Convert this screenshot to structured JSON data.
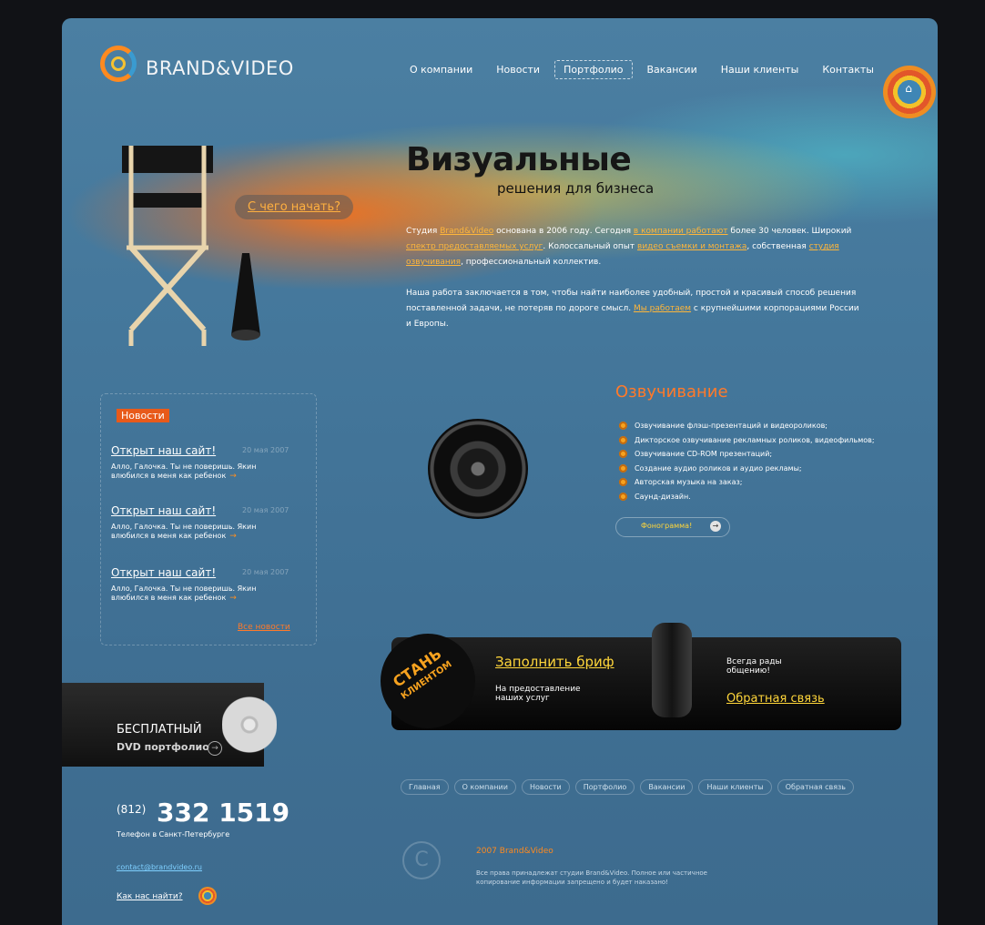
{
  "brand": {
    "logo_text": "BRAND&VIDEO"
  },
  "nav": [
    {
      "label": "О компании"
    },
    {
      "label": "Новости"
    },
    {
      "label": "Портфолио",
      "active": true
    },
    {
      "label": "Вакансии"
    },
    {
      "label": "Наши клиенты"
    },
    {
      "label": "Контакты"
    }
  ],
  "hero": {
    "cta": "С чего начать?",
    "title": "Визуальные",
    "subtitle": "решения для бизнеса",
    "p1_a": "Студия ",
    "p1_link1": "Brand&Video",
    "p1_b": " основана в 2006 году. Сегодня ",
    "p1_link2": "в компании работают",
    "p1_c": " более 30 человек. Широкий ",
    "p1_link3": "спектр предоставляемых услуг",
    "p1_d": ". Колоссальный опыт ",
    "p1_link4": "видео съемки и монтажа",
    "p1_e": ", собственная ",
    "p1_link5": "студия озвучивания",
    "p1_f": ", профессиональный коллектив.",
    "p2_a": "Наша работа заключается в том, чтобы найти наиболее удобный, простой и красивый способ решения поставленной задачи, не потеряв по дороге смысл. ",
    "p2_link": "Мы работаем",
    "p2_b": " с крупнейшими корпорациями России и Европы."
  },
  "news": {
    "tab": "Новости",
    "items": [
      {
        "title": "Открыт наш сайт!",
        "date": "20 мая 2007",
        "text": "Алло, Галочка. Ты не поверишь. Якин влюбился в меня как ребенок"
      },
      {
        "title": "Открыт наш сайт!",
        "date": "20 мая 2007",
        "text": "Алло, Галочка. Ты не поверишь. Якин влюбился в меня как ребенок"
      },
      {
        "title": "Открыт наш сайт!",
        "date": "20 мая 2007",
        "text": "Алло, Галочка. Ты не поверишь. Якин влюбился в меня как ребенок"
      }
    ],
    "more_arrow": "→",
    "all_link": "Все новости"
  },
  "dvd": {
    "title": "БЕСПЛАТНЫЙ",
    "subtitle": "DVD портфолио",
    "arrow": "→"
  },
  "contact": {
    "code": "(812)",
    "number": "332 1519",
    "caption": "Телефон в Санкт-Петербурге",
    "email": "contact@brandvideo.ru",
    "how_to_find": "Как нас найти?"
  },
  "sound": {
    "title": "Озвучивание",
    "items": [
      "Озвучивание флэш-презентаций и видеороликов;",
      "Дикторское озвучивание рекламных роликов, видеофильмов;",
      "Озвучивание CD-ROM презентаций;",
      "Создание аудио роликов и аудио рекламы;",
      "Авторская музыка на заказ;",
      "Саунд-дизайн."
    ],
    "button": "Фонограмма!",
    "button_arrow": "→"
  },
  "banner": {
    "stamp_line1": "СТАНЬ",
    "stamp_line2": "КЛИЕНТОМ",
    "brief_link": "Заполнить бриф",
    "brief_caption": "На предоставление наших услуг",
    "always": "Всегда рады общению!",
    "feedback_link": "Обратная связь"
  },
  "footer": {
    "nav": [
      "Главная",
      "О компании",
      "Новости",
      "Портфолио",
      "Вакансии",
      "Наши клиенты",
      "Обратная связь"
    ],
    "copy_symbol": "C",
    "year_line": "2007 Brand&Video",
    "rights": "Все права принадлежат студии Brand&Video. Полное или частичное копирование информации запрещено и будет наказано!"
  },
  "icons": {
    "home": "home-icon",
    "chair": "director-chair-icon",
    "megaphone": "megaphone-icon",
    "speaker": "speaker-icon",
    "dvd": "dvd-disc-icon",
    "mobile": "mobile-phone-icon",
    "locate": "locate-icon"
  },
  "colors": {
    "accent": "#ff7a2a",
    "link": "#ffb63a",
    "bg": "#44779b"
  }
}
